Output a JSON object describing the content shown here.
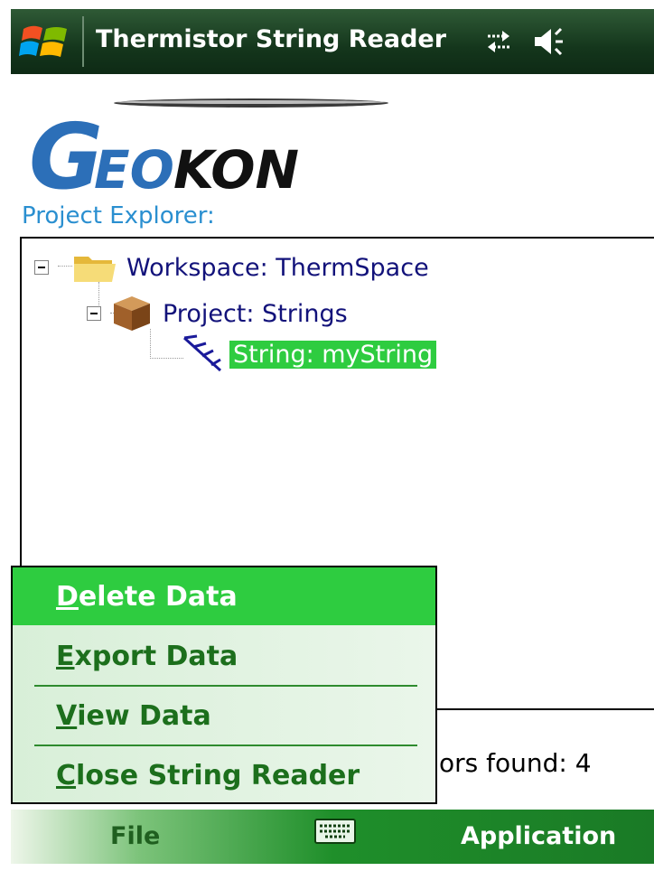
{
  "window": {
    "title": "Thermistor String Reader"
  },
  "logo": {
    "text": "GEOKON"
  },
  "project_explorer": {
    "label": "Project Explorer:",
    "tree": [
      {
        "label": "Workspace: ThermSpace",
        "icon": "folder-icon",
        "expanded": true
      },
      {
        "label": "Project: Strings",
        "icon": "box-icon",
        "expanded": true
      },
      {
        "label": "String: myString",
        "icon": "string-icon",
        "selected": true
      }
    ]
  },
  "menu": {
    "items": [
      {
        "key": "D",
        "rest": "elete Data",
        "active": true
      },
      {
        "key": "E",
        "rest": "xport Data"
      },
      {
        "key": "V",
        "rest": "iew Data"
      },
      {
        "key": "C",
        "rest": "lose String Reader"
      }
    ]
  },
  "status_text": "ors found: 4",
  "softkeys": {
    "left": "File",
    "right": "Application"
  },
  "colors": {
    "selection": "#2ecc40",
    "title_bar": "#14361c",
    "link_blue": "#2a8fd0",
    "menu_text": "#1c6f1c"
  }
}
